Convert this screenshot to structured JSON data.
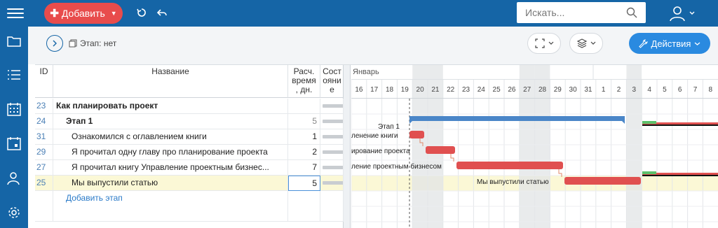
{
  "topbar": {
    "add_label": "Добавить",
    "search_placeholder": "Искать..."
  },
  "toolbar": {
    "stage_label": "Этап: нет",
    "actions_label": "Действия"
  },
  "table": {
    "headers": {
      "id": "ID",
      "name": "Название",
      "time": "Расч. время , дн.",
      "state": "Сост ояни е"
    },
    "rows": [
      {
        "id": "23",
        "name": "Как планировать проект",
        "time": "",
        "bold": true,
        "indent": 0
      },
      {
        "id": "24",
        "name": "Этап 1",
        "time": "5",
        "bold": true,
        "indent": 1
      },
      {
        "id": "31",
        "name": "Ознакомился с оглавлением книги",
        "time": "1",
        "bold": false,
        "indent": 2
      },
      {
        "id": "29",
        "name": "Я прочитал одну главу про планирование проекта",
        "time": "2",
        "bold": false,
        "indent": 2
      },
      {
        "id": "27",
        "name": "Я прочитал книгу Управление проектным бизнес...",
        "time": "7",
        "bold": false,
        "indent": 2
      },
      {
        "id": "25",
        "name": "Мы выпустили статью",
        "time": "5",
        "bold": false,
        "indent": 2,
        "selected": true
      }
    ],
    "add_stage_label": "Добавить этап"
  },
  "gantt": {
    "month_label": "Январь",
    "days": [
      "16",
      "17",
      "18",
      "19",
      "20",
      "21",
      "22",
      "23",
      "24",
      "25",
      "26",
      "27",
      "28",
      "29",
      "30",
      "31",
      "1",
      "2",
      "3",
      "4",
      "5",
      "6",
      "7",
      "8"
    ],
    "weekend_days": [
      "20",
      "21",
      "27",
      "28",
      "3"
    ],
    "labels": {
      "stage": "Этап 1",
      "task1": "ленение книги",
      "task2": "ирование проекта",
      "task3": "ление проектным бизнесом",
      "task4": "Мы выпустили статью"
    },
    "colors": {
      "stage_bar": "#4a86c8",
      "task_bar": "#e05050",
      "weekend": "#e2e4e6",
      "selected_row": "#fbf8d6"
    }
  }
}
